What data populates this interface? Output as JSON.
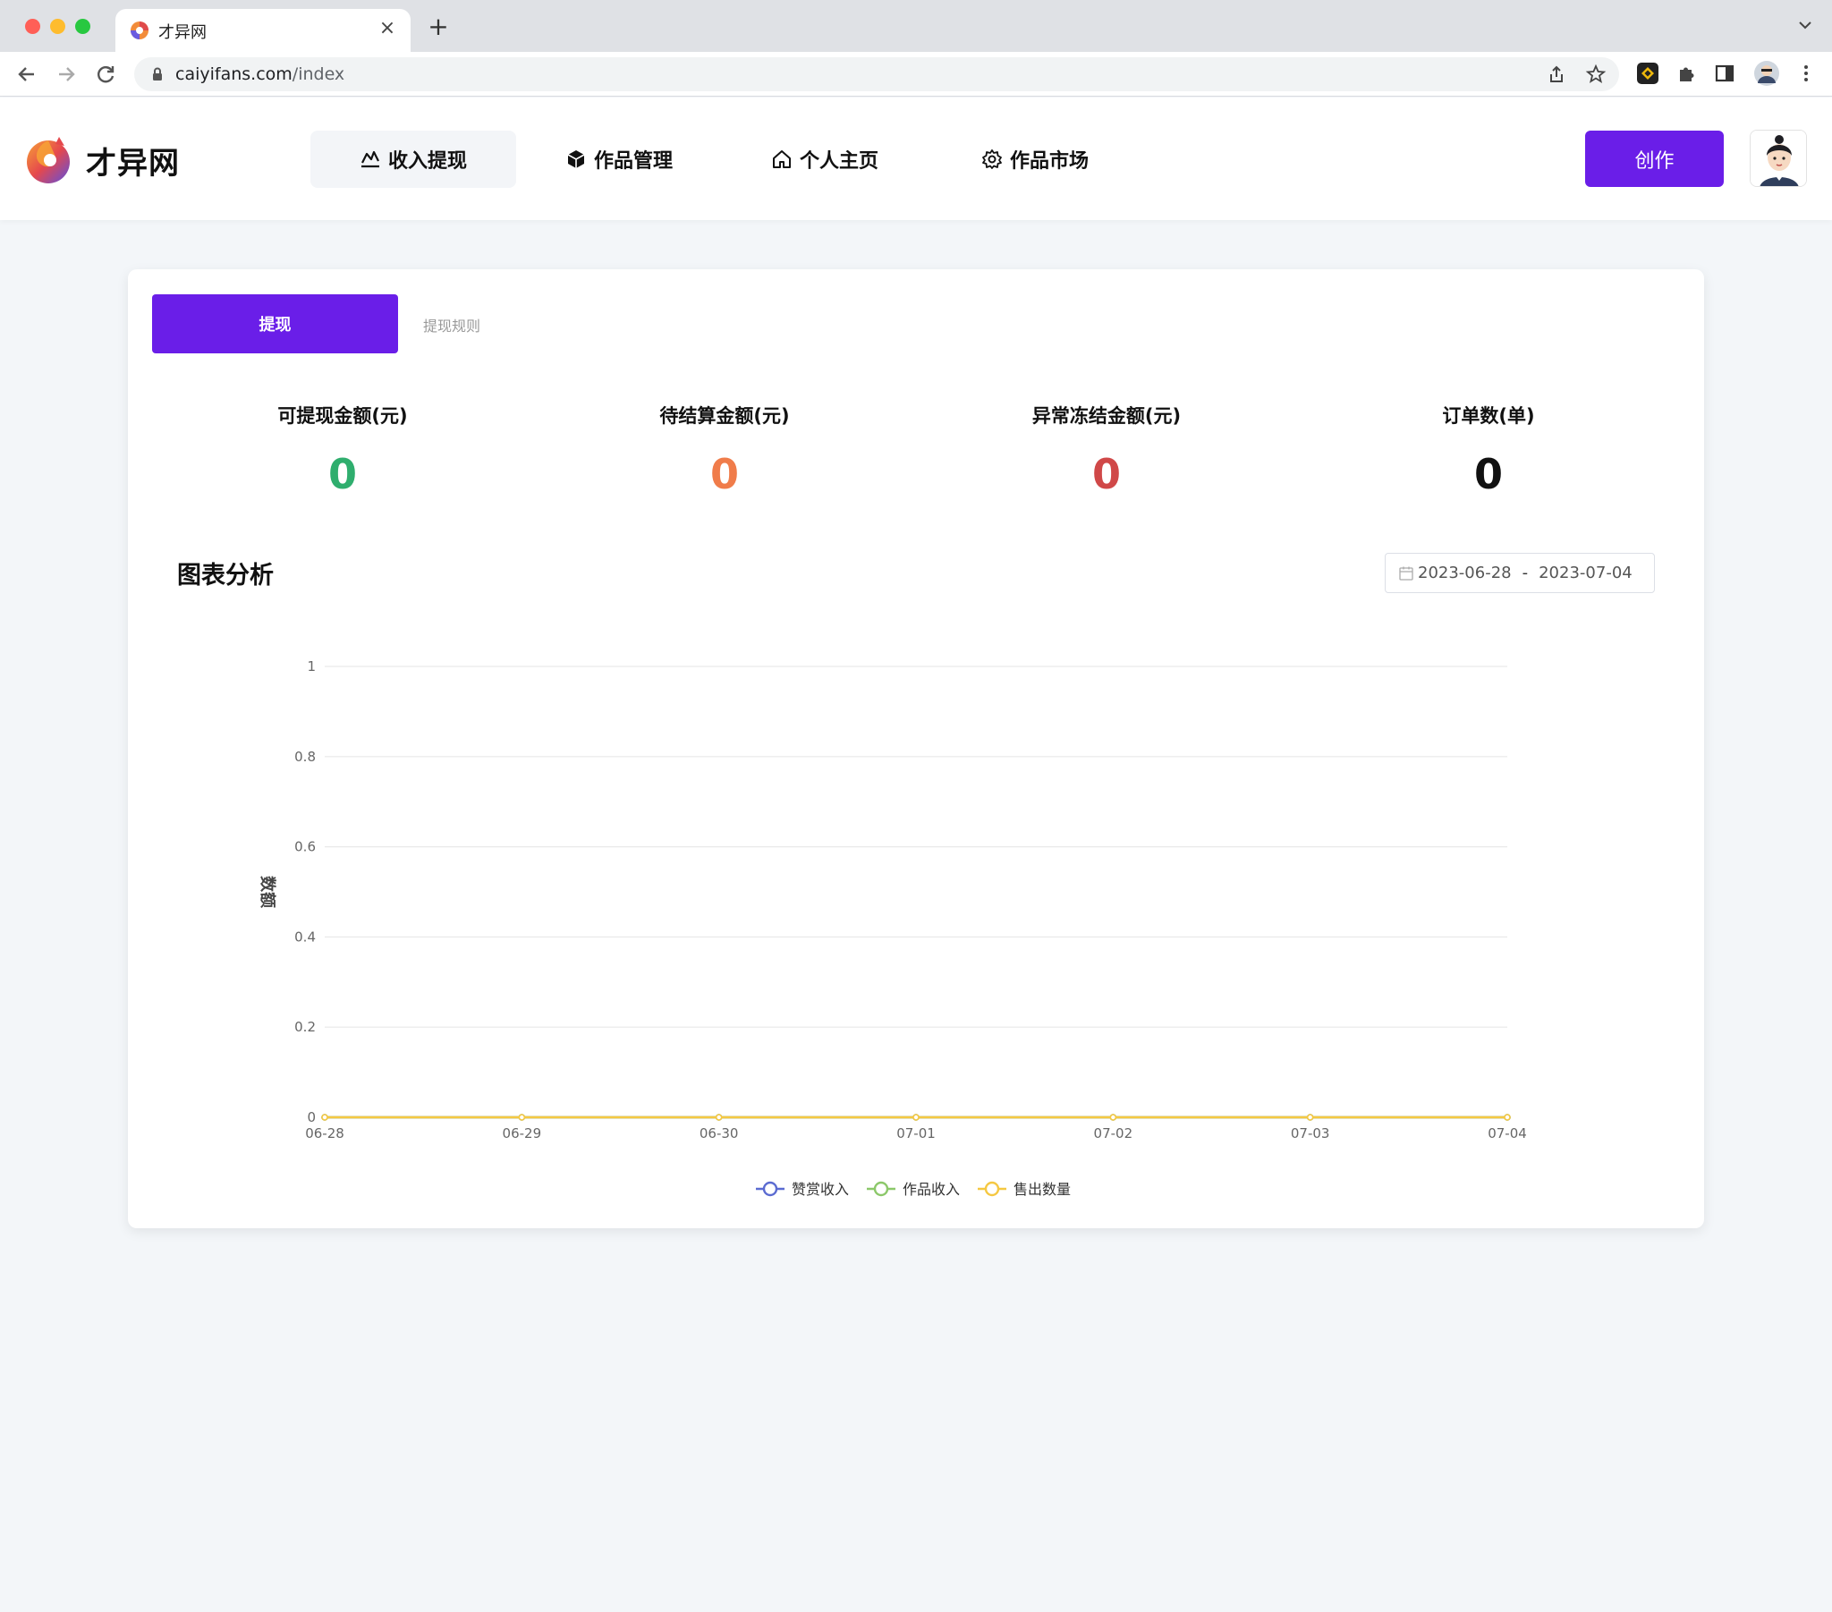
{
  "browser": {
    "tab_title": "才异网",
    "tab_close": "×",
    "new_tab": "+",
    "url_domain": "caiyifans.com",
    "url_path": "/index",
    "nav_icons": [
      "back-icon",
      "forward-icon",
      "reload-icon"
    ]
  },
  "site": {
    "logo_text": "才异网",
    "nav": [
      {
        "label": "收入提现",
        "icon": "chart-icon",
        "active": true
      },
      {
        "label": "作品管理",
        "icon": "cube-icon",
        "active": false
      },
      {
        "label": "个人主页",
        "icon": "home-icon",
        "active": false
      },
      {
        "label": "作品市场",
        "icon": "gear-icon",
        "active": false
      }
    ],
    "create_label": "创作"
  },
  "card": {
    "tab_active": "提现",
    "tab_inactive": "提现规则",
    "stats": [
      {
        "label": "可提现金额(元)",
        "value": "0",
        "color": "#2fae6e"
      },
      {
        "label": "待结算金额(元)",
        "value": "0",
        "color": "#f07c4a"
      },
      {
        "label": "异常冻结金额(元)",
        "value": "0",
        "color": "#d04848"
      },
      {
        "label": "订单数(单)",
        "value": "0",
        "color": "#111111"
      }
    ],
    "section_title": "图表分析",
    "date_start": "2023-06-28",
    "date_sep": "-",
    "date_end": "2023-07-04"
  },
  "chart_data": {
    "type": "line",
    "ylabel": "数额",
    "xlabel": "",
    "ylim": [
      0,
      1
    ],
    "yticks": [
      "0",
      "0.2",
      "0.4",
      "0.6",
      "0.8",
      "1"
    ],
    "categories": [
      "06-28",
      "06-29",
      "06-30",
      "07-01",
      "07-02",
      "07-03",
      "07-04"
    ],
    "series": [
      {
        "name": "赞赏收入",
        "color": "#5b6bd1",
        "values": [
          0,
          0,
          0,
          0,
          0,
          0,
          0
        ]
      },
      {
        "name": "作品收入",
        "color": "#8cc86a",
        "values": [
          0,
          0,
          0,
          0,
          0,
          0,
          0
        ]
      },
      {
        "name": "售出数量",
        "color": "#f5c842",
        "values": [
          0,
          0,
          0,
          0,
          0,
          0,
          0
        ]
      }
    ],
    "grid": true,
    "legend": "bottom-center"
  }
}
